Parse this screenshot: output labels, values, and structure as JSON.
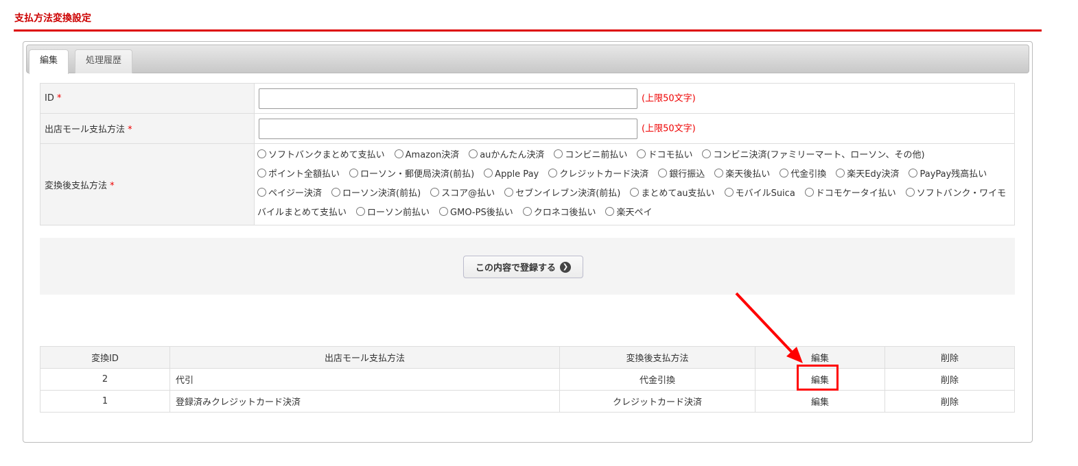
{
  "title": "支払方法変換設定",
  "tabs": [
    {
      "label": "編集"
    },
    {
      "label": "処理履歴"
    }
  ],
  "form": {
    "id_label": "ID",
    "mall_label": "出店モール支払方法",
    "conv_label": "変換後支払方法",
    "required": "*",
    "limit": "(上限50文字)",
    "id_value": "",
    "mall_value": "",
    "options": [
      "ソフトバンクまとめて支払い",
      "Amazon決済",
      "auかんたん決済",
      "コンビニ前払い",
      "ドコモ払い",
      "コンビニ決済(ファミリーマート、ローソン、その他)",
      "ポイント全額払い",
      "ローソン・郵便局決済(前払)",
      "Apple Pay",
      "クレジットカード決済",
      "銀行振込",
      "楽天後払い",
      "代金引換",
      "楽天Edy決済",
      "PayPay残高払い",
      "ペイジー決済",
      "ローソン決済(前払)",
      "スコア@払い",
      "セブンイレブン決済(前払)",
      "まとめてau支払い",
      "モバイルSuica",
      "ドコモケータイ払い",
      "ソフトバンク・ワイモバイルまとめて支払い",
      "ローソン前払い",
      "GMO-PS後払い",
      "クロネコ後払い",
      "楽天ペイ"
    ]
  },
  "submit_label": "この内容で登録する",
  "list": {
    "headers": [
      "変換ID",
      "出店モール支払方法",
      "変換後支払方法",
      "編集",
      "削除"
    ],
    "rows": [
      {
        "id": "2",
        "mall": "代引",
        "conv": "代金引換",
        "edit": "編集",
        "del": "削除"
      },
      {
        "id": "1",
        "mall": "登録済みクレジットカード決済",
        "conv": "クレジットカード決済",
        "edit": "編集",
        "del": "削除"
      }
    ]
  },
  "colors": {
    "accent": "#dd0000"
  }
}
